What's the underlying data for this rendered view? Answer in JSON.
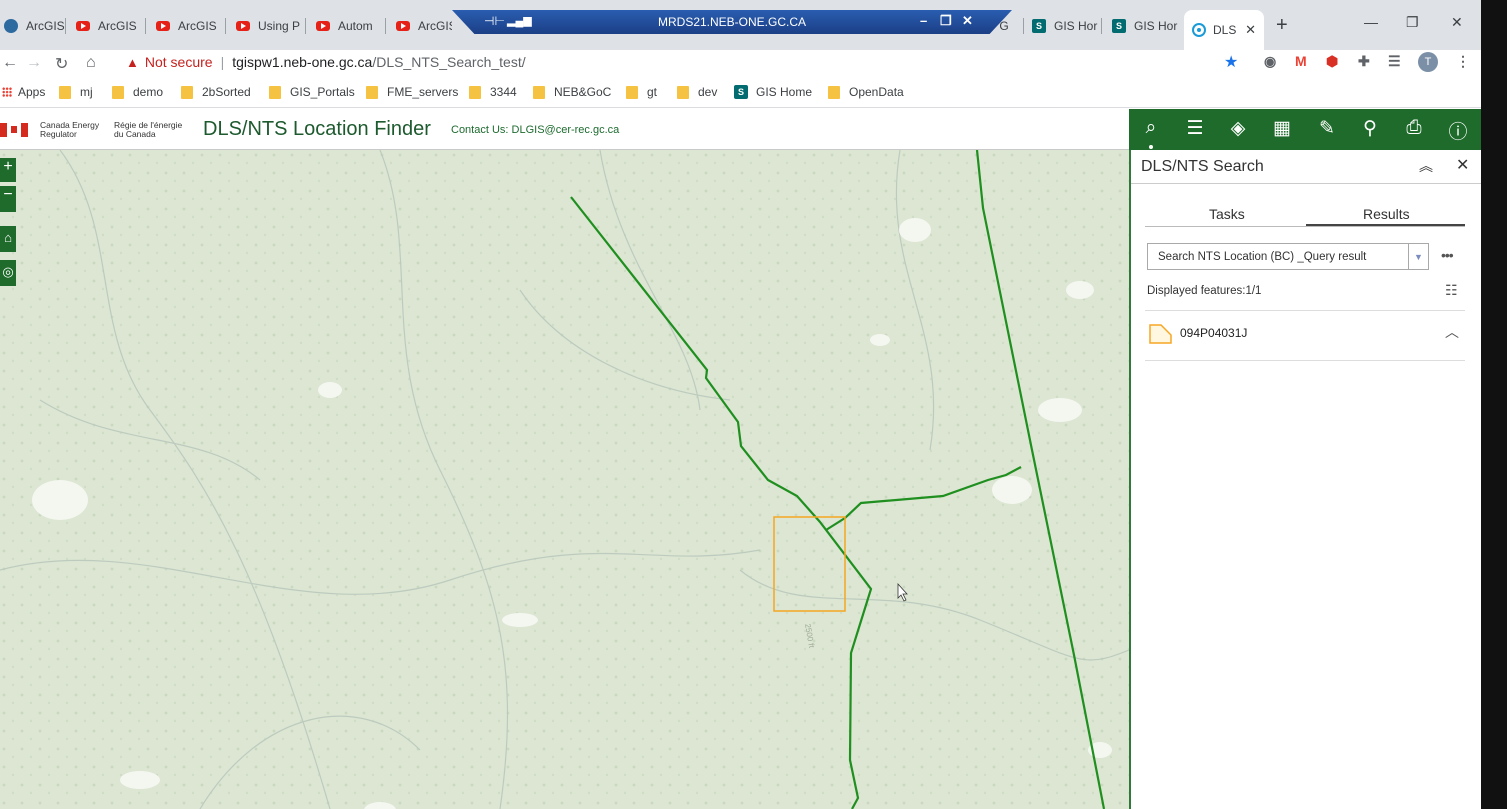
{
  "browser": {
    "tabs": [
      {
        "label": "ArcGIS",
        "icon": "globe-icon"
      },
      {
        "label": "ArcGIS",
        "icon": "youtube-icon"
      },
      {
        "label": "ArcGIS",
        "icon": "youtube-icon"
      },
      {
        "label": "Using P",
        "icon": "youtube-icon"
      },
      {
        "label": "Autom",
        "icon": "youtube-icon"
      },
      {
        "label": "ArcGIS",
        "icon": "youtube-icon"
      },
      {
        "label": "- G",
        "icon": "none"
      },
      {
        "label": "GIS Hor",
        "icon": "sharepoint-icon"
      },
      {
        "label": "GIS Hor",
        "icon": "sharepoint-icon"
      },
      {
        "label": "DLS",
        "icon": "web-app-icon"
      }
    ],
    "remote_desktop_title": "MRDS21.NEB-ONE.GC.CA",
    "security_label": "Not secure",
    "url_host": "tgispw1.neb-one.gc.ca",
    "url_path": "/DLS_NTS_Search_test/",
    "profile_initial": "T",
    "bookmarks": [
      "Apps",
      "mj",
      "demo",
      "2bSorted",
      "GIS_Portals",
      "FME_servers",
      "3344",
      "NEB&GoC",
      "gt",
      "dev",
      "GIS Home",
      "OpenData"
    ]
  },
  "app": {
    "org_en": "Canada Energy\nRegulator",
    "org_fr": "Régie de l'énergie\ndu Canada",
    "title": "DLS/NTS Location Finder",
    "contact": "Contact Us: DLGIS@cer-rec.gc.ca"
  },
  "map": {
    "zoom_in": "+",
    "zoom_out": "−",
    "contour_label": "2500 ft",
    "pipeline_color": "#1f8f1f",
    "highlight_color": "#f5a623"
  },
  "panel": {
    "title": "DLS/NTS Search",
    "tabs": [
      "Tasks",
      "Results"
    ],
    "active_tab": "Results",
    "query_select": "Search NTS Location (BC) _Query result",
    "displayed_features": "Displayed features:1/1",
    "results": [
      {
        "name": "094P04031J"
      }
    ]
  }
}
